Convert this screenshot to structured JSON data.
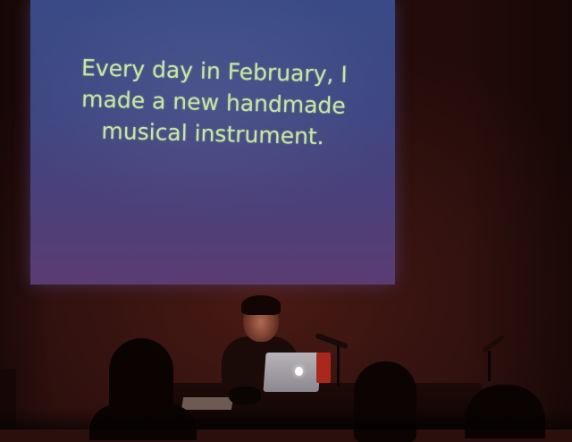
{
  "slide": {
    "lines": [
      "Every day in February, I",
      "made a new handmade",
      "musical instrument."
    ]
  },
  "colors": {
    "slide_text": "#c7e6a2",
    "screen_top": "#3a4a86",
    "screen_bottom": "#5a3c72",
    "wall": "#4a1a14"
  }
}
